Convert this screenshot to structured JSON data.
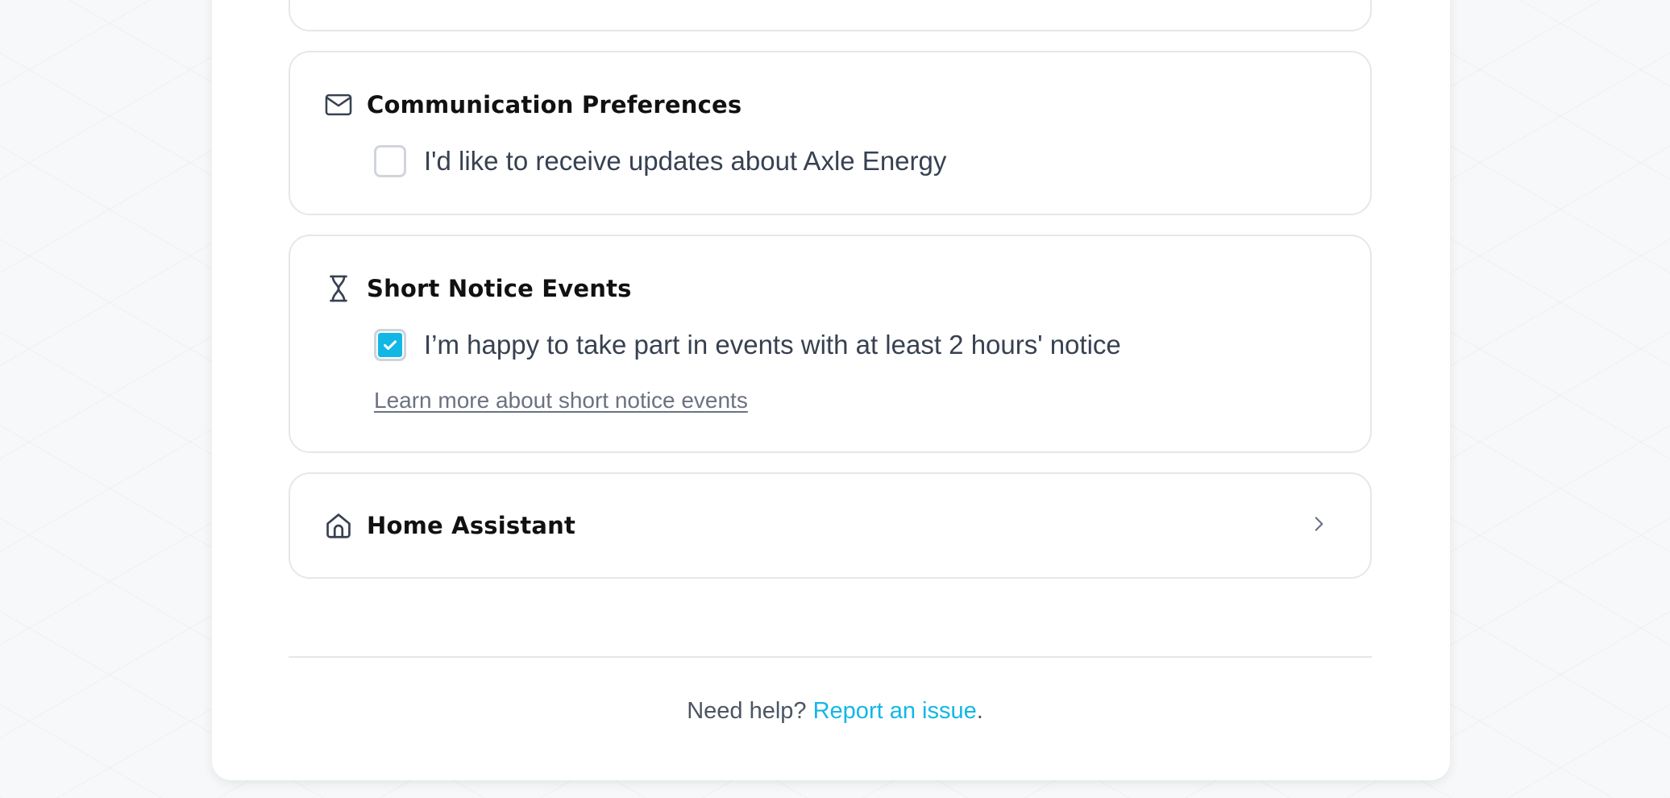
{
  "cards": {
    "communication": {
      "icon": "mail-icon",
      "title": "Communication Preferences",
      "option": {
        "label": "I'd like to receive updates about Axle Energy",
        "checked": false
      }
    },
    "short_notice": {
      "icon": "hourglass-icon",
      "title": "Short Notice Events",
      "option": {
        "label": "I’m happy to take part in events with at least 2 hours' notice",
        "checked": true
      },
      "link": "Learn more about short notice events"
    },
    "home_assistant": {
      "icon": "home-icon",
      "title": "Home Assistant",
      "action_icon": "chevron-right-icon"
    }
  },
  "footer": {
    "prefix": "Need help? ",
    "link": "Report an issue",
    "suffix": "."
  },
  "colors": {
    "accent": "#12b7e6",
    "border": "#e5e7eb",
    "text": "#374151",
    "title": "#111111"
  }
}
